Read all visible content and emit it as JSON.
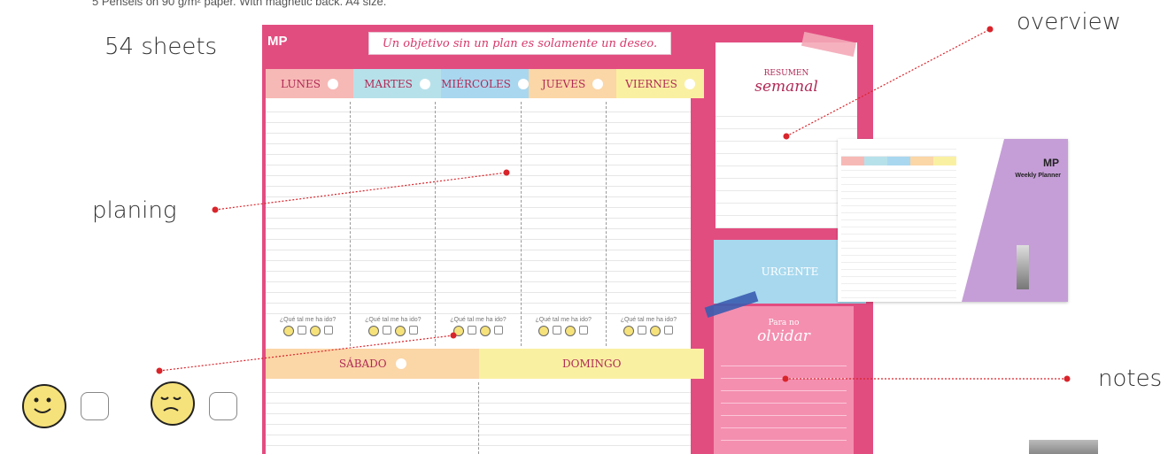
{
  "caption": "5 Pehsels on 90 g/m² paper. With magnetic back. A4 size.",
  "labels": {
    "sheets": "54 sheets",
    "planing": "planing",
    "overview": "overview",
    "notes": "notes"
  },
  "planner": {
    "logo": "MP",
    "banner": "Un objetivo sin un plan es solamente un deseo.",
    "days": [
      "LUNES",
      "MARTES",
      "MIÉRCOLES",
      "JUEVES",
      "VIERNES"
    ],
    "day_colors": [
      "#f7b9b6",
      "#b7e1ea",
      "#a9d7f0",
      "#fbd6a7",
      "#faf0a2"
    ],
    "weekend": [
      "SÁBADO",
      "DOMINGO"
    ],
    "weekend_colors": [
      "#fbd6a7",
      "#faf0a2"
    ],
    "mood_label": "¿Qué tal me ha ido?",
    "summary_title_top": "RESUMEN",
    "summary_title_bottom": "semanal",
    "urgent": "URGENTE",
    "forget_top": "Para no",
    "forget_bottom": "olvidar"
  },
  "product": {
    "logo": "MP",
    "title": "Weekly Planner"
  },
  "colors": {
    "board_pink": "#e24d80",
    "pointer_red": "#d9242b",
    "happy_yellow": "#f6e27a"
  }
}
